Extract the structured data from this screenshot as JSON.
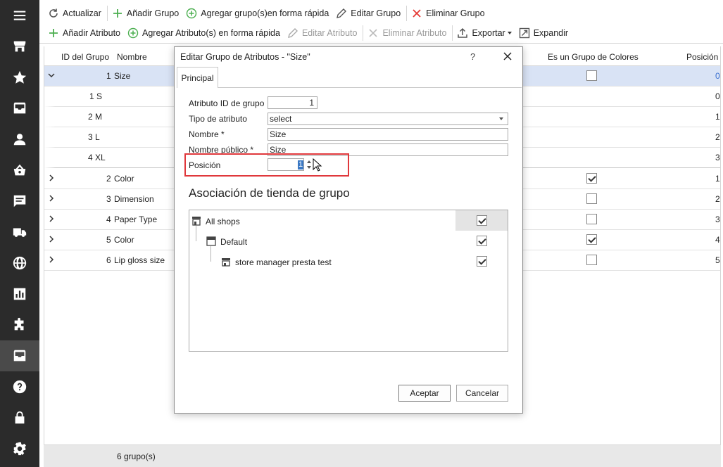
{
  "toolbar_row1": {
    "refresh": "Actualizar",
    "add_group": "Añadir Grupo",
    "quick_add_group": "Agregar grupo(s)en forma rápida",
    "edit_group": "Editar Grupo",
    "delete_group": "Eliminar Grupo"
  },
  "toolbar_row2": {
    "add_attribute": "Añadir Atributo",
    "quick_add_attribute": "Agregar Atributo(s) en forma rápida",
    "edit_attribute": "Editar Atributo",
    "delete_attribute": "Eliminar Atributo",
    "export": "Exportar",
    "expand": "Expandir"
  },
  "grid": {
    "headers": {
      "id": "ID del Grupo",
      "name": "Nombre",
      "is_color": "Es un Grupo de Colores",
      "position": "Posición"
    },
    "rows": [
      {
        "id": "1",
        "name": "Size",
        "position": "0",
        "color": false,
        "selected": true
      },
      {
        "id": "1 S",
        "position": "0"
      },
      {
        "id": "2 M",
        "position": "1"
      },
      {
        "id": "3 L",
        "position": "2"
      },
      {
        "id": "4 XL",
        "position": "3"
      },
      {
        "id": "2",
        "name": "Color",
        "position": "1",
        "color": true
      },
      {
        "id": "3",
        "name": "Dimension",
        "position": "2",
        "color": false
      },
      {
        "id": "4",
        "name": "Paper Type",
        "position": "3",
        "color": false
      },
      {
        "id": "5",
        "name": "Color",
        "position": "4",
        "color": true
      },
      {
        "id": "6",
        "name": "Lip gloss size",
        "position": "5",
        "color": false
      }
    ],
    "footer": "6 grupo(s)"
  },
  "dialog": {
    "title": "Editar Grupo de Atributos - \"Size\"",
    "help": "?",
    "tab": "Principal",
    "fields": {
      "group_id_label": "Atributo ID de grupo",
      "group_id_value": "1",
      "type_label": "Tipo de atributo",
      "type_value": "select",
      "name_label": "Nombre *",
      "name_value": "Size",
      "public_name_label": "Nombre público *",
      "public_name_value": "Size",
      "position_label": "Posición",
      "position_value": "1"
    },
    "store_section_title": "Asociación de tienda de grupo",
    "stores": [
      {
        "label": "All shops",
        "checked": true
      },
      {
        "label": "Default",
        "checked": true
      },
      {
        "label": "store manager presta test",
        "checked": true
      }
    ],
    "accept": "Aceptar",
    "cancel": "Cancelar"
  },
  "colors": {
    "sidebar_bg": "#2b2b2b",
    "selected_row": "#d9e3f5",
    "highlight_box": "#e0383c",
    "add_icon": "#4caf50",
    "delete_icon": "#e53935"
  }
}
